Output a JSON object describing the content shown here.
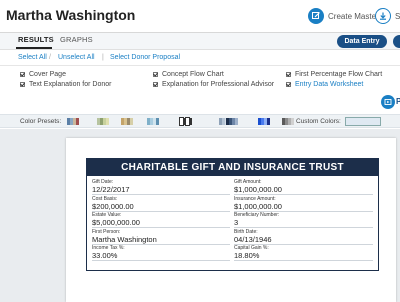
{
  "header": {
    "client_name": "Martha Washington",
    "create_master_label": "Create Master",
    "save_label": "Sa"
  },
  "tabs": {
    "results": "RESULTS",
    "separator": "/",
    "graphs": "GRAPHS",
    "data_entry": "Data Entry"
  },
  "selection": {
    "select_all": "Select All",
    "sep": "/",
    "unselect_all": "Unselect All",
    "sep2": "|",
    "select_donor_proposal": "Select Donor Proposal"
  },
  "options": [
    {
      "label": "Cover Page",
      "checked": true
    },
    {
      "label": "Text Explanation for Donor",
      "checked": true
    },
    {
      "label": "Concept Flow Chart",
      "checked": true
    },
    {
      "label": "Explanation for Professional Advisor",
      "checked": true
    },
    {
      "label": "First Percentage Flow Chart",
      "checked": true
    },
    {
      "label": "Entry Data Worksheet",
      "checked": true
    }
  ],
  "print_label": "P",
  "colors": {
    "presets_label": "Color Presets:",
    "custom_label": "Custom Colors:",
    "presets": [
      [
        "#5b7fa6",
        "#8aa7c4",
        "#c9b79c",
        "#a04f4f"
      ],
      [
        "#b7c4a0",
        "#8fa16f",
        "#c7d19d",
        "#e0e0b0"
      ],
      [
        "#c4a46a",
        "#d8c28f",
        "#9a8a6a",
        "#d6cfa8"
      ],
      [
        "#7fb0c9",
        "#a9cde0",
        "#d0e4ee",
        "#5d8fb0"
      ],
      [
        "#ffffff",
        "#333333",
        "#ffffff",
        "#333333"
      ],
      [
        "#8fa2b8",
        "#b7c6d6",
        "#d7e0ea",
        "#6c84a0"
      ],
      [
        "#1c2e4a",
        "#3a5478",
        "#6d86a8",
        "#9eb1cb"
      ],
      [
        "#1a4fd0",
        "#4a7bef",
        "#8fb0f5",
        "#1a2f8a"
      ],
      [
        "#5a5a5a",
        "#8a8a8a",
        "#b0b0b0",
        "#d0d0d0"
      ]
    ]
  },
  "report": {
    "title": "CHARITABLE GIFT AND INSURANCE TRUST",
    "fields": [
      {
        "label": "Gift Date:",
        "value": "12/22/2017"
      },
      {
        "label": "Gift Amount:",
        "value": "$1,000,000.00"
      },
      {
        "label": "Cost Basis:",
        "value": "$200,000.00"
      },
      {
        "label": "Insurance Amount:",
        "value": "$1,000,000.00"
      },
      {
        "label": "Estate Value:",
        "value": "$5,000,000.00"
      },
      {
        "label": "Beneficiary Number:",
        "value": "3"
      },
      {
        "label": "First Person:",
        "value": "Martha Washington"
      },
      {
        "label": "Birth Date:",
        "value": "04/13/1946"
      },
      {
        "label": "Income Tax %:",
        "value": "33.00%"
      },
      {
        "label": "Capital Gain %:",
        "value": "18.80%"
      }
    ]
  }
}
